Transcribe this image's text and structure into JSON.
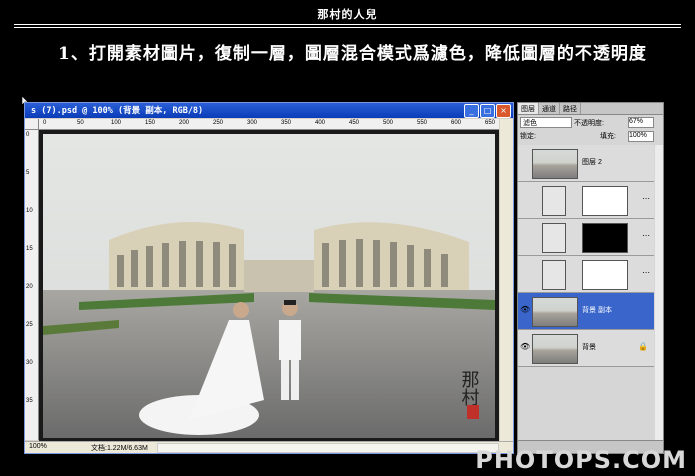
{
  "header": {
    "title": "那村的人兒"
  },
  "instruction": "1、打開素材圖片，復制一層，圖層混合模式爲濾色，降低圖層的不透明度",
  "document": {
    "title": "s (7).psd @ 100% (背景 副本, RGB/8)",
    "zoom": "100%",
    "doc_size": "文档:1.22M/6.63M",
    "ruler_ticks": [
      "0",
      "50",
      "100",
      "150",
      "200",
      "250",
      "300",
      "350",
      "400",
      "450",
      "500",
      "550",
      "600",
      "650"
    ],
    "vruler_ticks": [
      "0",
      "5",
      "10",
      "15",
      "20",
      "25",
      "30",
      "35"
    ]
  },
  "layers_panel": {
    "tabs": [
      "图层",
      "通道",
      "路径"
    ],
    "blend_mode": "滤色",
    "opacity_label": "不透明度:",
    "opacity": "67%",
    "lock_label": "锁定:",
    "fill_label": "填充:",
    "fill": "100%",
    "layers": [
      {
        "name": "图层 2",
        "visible": false,
        "selected": false,
        "type": "pixel"
      },
      {
        "name": "",
        "visible": false,
        "selected": false,
        "type": "adjustment-white"
      },
      {
        "name": "",
        "visible": false,
        "selected": false,
        "type": "adjustment-black"
      },
      {
        "name": "",
        "visible": false,
        "selected": false,
        "type": "adjustment-white"
      },
      {
        "name": "背景 副本",
        "visible": true,
        "selected": true,
        "type": "pixel"
      },
      {
        "name": "背景",
        "visible": true,
        "selected": false,
        "type": "background"
      }
    ]
  },
  "watermark": "PHOTOPS.COM",
  "colors": {
    "accent": "#3a66cc",
    "titlebar": "#0a3cb8"
  }
}
